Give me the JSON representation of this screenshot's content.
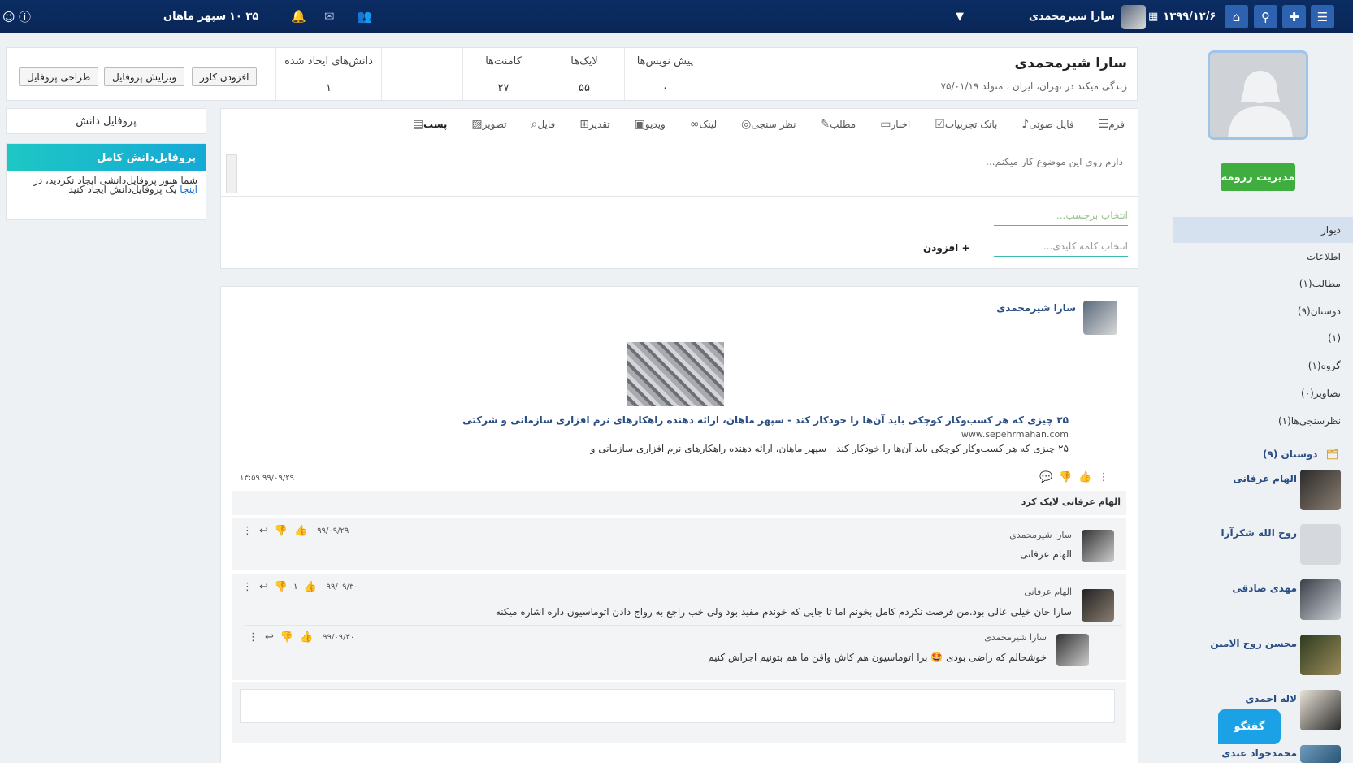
{
  "topbar": {
    "menu_icon": "hamburger-icon",
    "date": "۱۳۹۹/۱۲/۶",
    "user_name": "سارا شیرمحمدی",
    "time": "۱۰ ۳۵",
    "org_name": "سپهر ماهان",
    "dropdown_icon": "caret-down-icon"
  },
  "profile": {
    "name": "سارا شیرمحمدی",
    "desc": "زندگی میکند در تهران، ایران ، متولد ۷۵/۰۱/۱۹",
    "stats": [
      {
        "label": "پیش نویس‌ها",
        "value": "۰"
      },
      {
        "label": "لایک‌ها",
        "value": "۵۵"
      },
      {
        "label": "کامنت‌ها",
        "value": "۲۷"
      },
      {
        "label": "دانش‌های ایجاد شده",
        "value": "۱"
      }
    ],
    "buttons": {
      "add_cover": "افزودن کاور",
      "edit_profile": "ویرایش پروفایل",
      "design_profile": "طراحی پروفایل"
    }
  },
  "sidebar_right": {
    "resume_button": "مدیریت رزومه",
    "nav": [
      {
        "label": "دیوار"
      },
      {
        "label": "اطلاعات"
      },
      {
        "label": "مطالب(۱)"
      },
      {
        "label": "دوستان(۹)"
      },
      {
        "label": "(۱)"
      },
      {
        "label": "گروه(۱)"
      },
      {
        "label": "تصاویر(۰)"
      },
      {
        "label": "نظرسنجی‌ها(۱)"
      }
    ],
    "friends_title": "دوستان (۹)",
    "friends": [
      {
        "name": "الهام عرفانی"
      },
      {
        "name": "روح الله شکرآرا"
      },
      {
        "name": "مهدی صادقی"
      },
      {
        "name": "محسن روح الامین"
      },
      {
        "name": "لاله احمدی"
      },
      {
        "name": "محمدجواد عبدی"
      }
    ],
    "chat_button": "گفتگو"
  },
  "knowledge": {
    "title": "پروفایل دانش",
    "box_title": "پروفایل‌دانش کامل",
    "text_before": "شما هنوز پروفایل‌دانشی ایجاد نکردید، در",
    "link": "اینجا",
    "text_after": "یک پروفایل‌دانش ایجاد کنید"
  },
  "composer": {
    "tabs": [
      {
        "label": "پست",
        "icon": "post-icon"
      },
      {
        "label": "تصویر",
        "icon": "image-icon"
      },
      {
        "label": "فایل",
        "icon": "paperclip-icon"
      },
      {
        "label": "تقدیر",
        "icon": "gift-icon"
      },
      {
        "label": "ویدیو",
        "icon": "film-icon"
      },
      {
        "label": "لینک",
        "icon": "link-icon"
      },
      {
        "label": "نظر سنجی",
        "icon": "poll-icon"
      },
      {
        "label": "مطلب",
        "icon": "article-icon"
      },
      {
        "label": "اخبار",
        "icon": "news-icon"
      },
      {
        "label": "بانک تجربیات",
        "icon": "checklist-icon"
      },
      {
        "label": "فایل صوتی",
        "icon": "microphone-icon"
      },
      {
        "label": "فرم",
        "icon": "form-icon"
      }
    ],
    "placeholder": "دارم روی این موضوع کار میکنم...",
    "tag_placeholder": "انتخاب برچسب...",
    "keyword_placeholder": "انتخاب کلمه کلیدی...",
    "add_label": "+ افزودن"
  },
  "post": {
    "author": "سارا شیرمحمدی",
    "link_title": "۲۵ چیزی که هر کسب‌وکار کوچکی باید آن‌ها را خودکار کند - سپهر ماهان، ارائه دهنده راهکارهای نرم افزاری سازمانی و شرکتی",
    "link_url": "www.sepehrmahan.com",
    "link_desc": "۲۵ چیزی که هر کسب‌وکار کوچکی باید آن‌ها را خودکار کند - سپهر ماهان، ارائه دهنده راهکارهای نرم افزاری سازمانی و",
    "timestamp": "۹۹/۰۹/۲۹ ۱۳:۵۹",
    "liked_by": "الهام عرفانی لایک کرد"
  },
  "comments": [
    {
      "author": "سارا شیرمحمدی",
      "text": "الهام عرفانی",
      "date": "۹۹/۰۹/۲۹",
      "likes": ""
    },
    {
      "author": "الهام عرفانی",
      "text": "سارا جان خیلی عالی بود.من فرصت نکردم کامل بخونم اما تا جایی که خوندم  مفید بود ولی خب راجع به رواج دادن اتوماسیون داره اشاره میکنه",
      "date": "۹۹/۰۹/۳۰",
      "likes": "۱"
    },
    {
      "author": "سارا شیرمحمدی",
      "text": "خوشحالم که راضی بودی 🤩 برا اتوماسیون هم کاش واقن ما هم بتونیم اجراش کنیم",
      "date": "۹۹/۰۹/۳۰",
      "likes": ""
    }
  ]
}
